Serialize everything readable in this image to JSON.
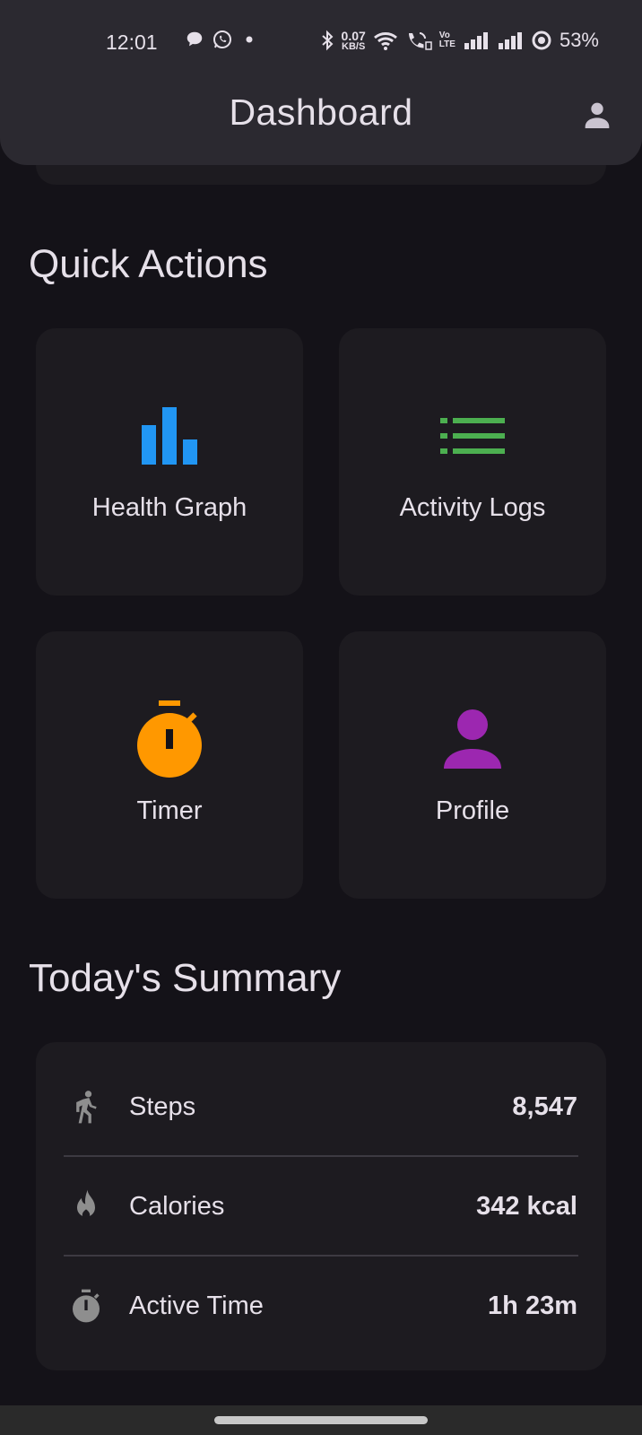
{
  "status_bar": {
    "time": "12:01",
    "speed_value": "0.07",
    "speed_unit": "KB/S",
    "volte_top": "Vo",
    "volte_bottom": "LTE",
    "battery": "53%"
  },
  "header": {
    "title": "Dashboard",
    "account_icon": "account-icon"
  },
  "quick_actions": {
    "title": "Quick Actions",
    "items": [
      {
        "label": "Health Graph",
        "icon": "bar-chart-icon",
        "color": "#2196f3"
      },
      {
        "label": "Activity Logs",
        "icon": "list-icon",
        "color": "#4caf50"
      },
      {
        "label": "Timer",
        "icon": "timer-icon",
        "color": "#ff9800"
      },
      {
        "label": "Profile",
        "icon": "person-icon",
        "color": "#9c27b0"
      }
    ]
  },
  "summary": {
    "title": "Today's Summary",
    "rows": [
      {
        "label": "Steps",
        "value": "8,547",
        "icon": "walking-icon"
      },
      {
        "label": "Calories",
        "value": "342 kcal",
        "icon": "flame-icon"
      },
      {
        "label": "Active Time",
        "value": "1h 23m",
        "icon": "stopwatch-icon"
      }
    ]
  },
  "colors": {
    "background": "#141218",
    "app_bar": "#2b2930",
    "card": "#1d1b20",
    "text": "#e6e0e9",
    "summary_icon": "#8e8e8e"
  }
}
